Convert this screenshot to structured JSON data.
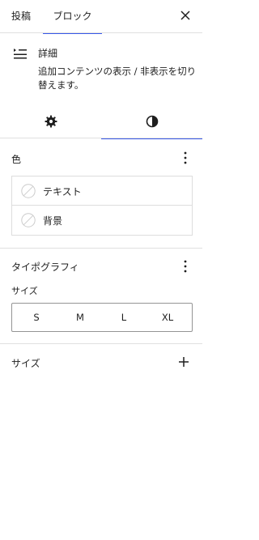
{
  "header": {
    "tabs": [
      {
        "label": "投稿"
      },
      {
        "label": "ブロック"
      }
    ],
    "close_icon": "close-icon"
  },
  "block": {
    "icon": "details-icon",
    "title": "詳細",
    "description": "追加コンテンツの表示 / 非表示を切り替えます。"
  },
  "inspector_tabs": [
    {
      "icon": "gear-icon"
    },
    {
      "icon": "contrast-icon"
    }
  ],
  "color_panel": {
    "title": "色",
    "items": [
      {
        "label": "テキスト"
      },
      {
        "label": "背景"
      }
    ]
  },
  "typography_panel": {
    "title": "タイポグラフィ",
    "size_label": "サイズ",
    "size_options": [
      "S",
      "M",
      "L",
      "XL"
    ]
  },
  "dimensions_panel": {
    "title": "サイズ"
  },
  "colors": {
    "accent": "#3858e9",
    "border": "#e0e0e0",
    "text": "#1e1e1e"
  }
}
